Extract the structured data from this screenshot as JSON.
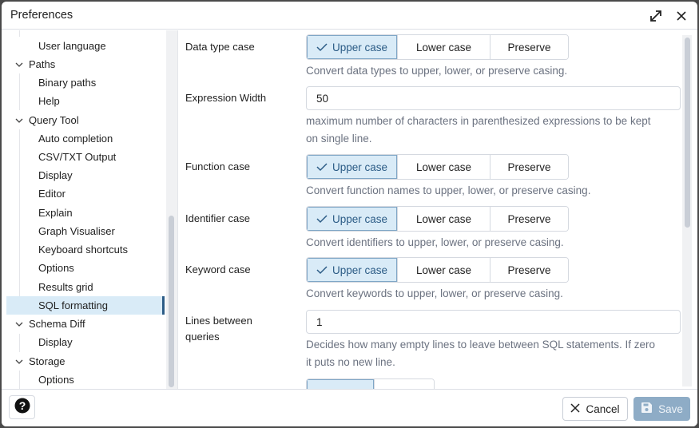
{
  "window": {
    "title": "Preferences",
    "maximize_icon": "expand-arrows-icon",
    "close_icon": "close-x-icon"
  },
  "tree": {
    "items": [
      {
        "label": "User language",
        "level": "child"
      },
      {
        "label": "Paths",
        "level": "parent",
        "expanded": true
      },
      {
        "label": "Binary paths",
        "level": "child"
      },
      {
        "label": "Help",
        "level": "child"
      },
      {
        "label": "Query Tool",
        "level": "parent",
        "expanded": true
      },
      {
        "label": "Auto completion",
        "level": "child"
      },
      {
        "label": "CSV/TXT Output",
        "level": "child"
      },
      {
        "label": "Display",
        "level": "child"
      },
      {
        "label": "Editor",
        "level": "child"
      },
      {
        "label": "Explain",
        "level": "child"
      },
      {
        "label": "Graph Visualiser",
        "level": "child"
      },
      {
        "label": "Keyboard shortcuts",
        "level": "child"
      },
      {
        "label": "Options",
        "level": "child"
      },
      {
        "label": "Results grid",
        "level": "child"
      },
      {
        "label": "SQL formatting",
        "level": "child",
        "selected": true
      },
      {
        "label": "Schema Diff",
        "level": "parent",
        "expanded": true
      },
      {
        "label": "Display",
        "level": "child"
      },
      {
        "label": "Storage",
        "level": "parent",
        "expanded": true
      },
      {
        "label": "Options",
        "level": "child"
      }
    ]
  },
  "settings": {
    "data_type_case": {
      "label": "Data type case",
      "options": [
        "Upper case",
        "Lower case",
        "Preserve"
      ],
      "selected": "Upper case",
      "help": "Convert data types to upper, lower, or preserve casing."
    },
    "expression_width": {
      "label": "Expression Width",
      "value": "50",
      "help_line1": "maximum number of characters in parenthesized expressions to be kept",
      "help_line2": "on single line."
    },
    "function_case": {
      "label": "Function case",
      "options": [
        "Upper case",
        "Lower case",
        "Preserve"
      ],
      "selected": "Upper case",
      "help": "Convert function names to upper, lower, or preserve casing."
    },
    "identifier_case": {
      "label": "Identifier case",
      "options": [
        "Upper case",
        "Lower case",
        "Preserve"
      ],
      "selected": "Upper case",
      "help": "Convert identifiers to upper, lower, or preserve casing."
    },
    "keyword_case": {
      "label": "Keyword case",
      "options": [
        "Upper case",
        "Lower case",
        "Preserve"
      ],
      "selected": "Upper case",
      "help": "Convert keywords to upper, lower, or preserve casing."
    },
    "lines_between_queries": {
      "label_line1": "Lines between",
      "label_line2": "queries",
      "value": "1",
      "help_line1": "Decides how many empty lines to leave between SQL statements. If zero",
      "help_line2": "it puts no new line."
    }
  },
  "footer": {
    "help_icon": "question-circle-icon",
    "cancel_label": "Cancel",
    "save_label": "Save"
  },
  "colors": {
    "accent": "#2c5c86",
    "selected_bg": "#d9ebf7",
    "save_disabled_bg": "#8eacc6"
  }
}
